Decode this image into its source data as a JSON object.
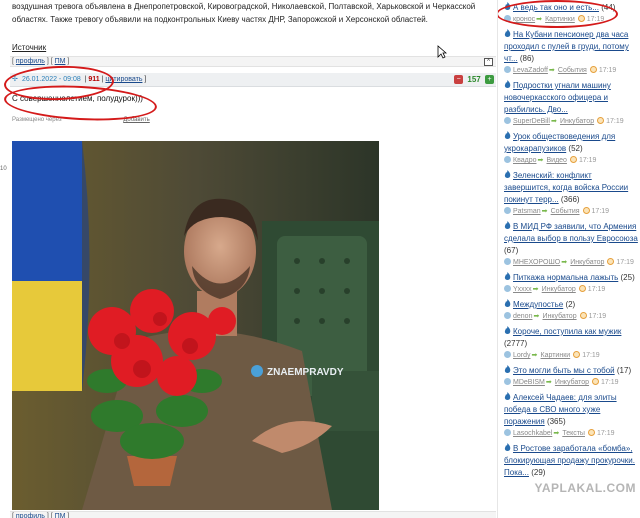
{
  "post": {
    "text": "воздушная тревога объявлена в Днепропетровской, Кировоградской, Николаевской, Полтавской, Харьковской и Черкасской областях. Также тревогу объявили на подконтрольных Киеву частях ДНР, Запорожской и Херсонской областей.",
    "source_link": "Источник"
  },
  "footer_links": {
    "profile": "профиль",
    "pm": "ПМ",
    "up": "^"
  },
  "comment": {
    "date": "26.01.2022 - 09:08",
    "number": "911",
    "quote": "цитировать",
    "score": "157",
    "text": "С совершеннолетием, полудурок)))",
    "meta_prefix": "Размещено через",
    "meta_link": "Добавить"
  },
  "side_number": "10",
  "photo": {
    "watermark": "ZNAEMPRAVDY"
  },
  "sidebar": {
    "items": [
      {
        "title": "А ведь так оно и есть...",
        "count": "(44)",
        "user": "кронос",
        "cat": "Картинки",
        "time": "17:19"
      },
      {
        "title": "На Кубани пенсионер два часа проходил с пулей в груди, потому чт...",
        "count": "(86)",
        "user": "LevaZadoff",
        "cat": "События",
        "time": "17:19"
      },
      {
        "title": "Подростки угнали машину новочеркасского офицера и разбились. Дво...",
        "count": "",
        "user": "SuperDeBill",
        "cat": "Инкубатор",
        "time": "17:19"
      },
      {
        "title": "Урок обществоведения для укрокарапузиков",
        "count": "(52)",
        "user": "Квадро",
        "cat": "Видео",
        "time": "17:19"
      },
      {
        "title": "Зеленский: конфликт завершится, когда войска России покинут терр...",
        "count": "(366)",
        "user": "Patsman",
        "cat": "События",
        "time": "17:19"
      },
      {
        "title": "В МИД РФ заявили, что Армения сделала выбор в пользу Евросоюза",
        "count": "(67)",
        "user": "МНЕХОРОШО",
        "cat": "Инкубатор",
        "time": "17:19"
      },
      {
        "title": "Питкажа нормальна лажыть",
        "count": "(25)",
        "user": "Yxxxx",
        "cat": "Инкубатор",
        "time": "17:19"
      },
      {
        "title": "Междупостье",
        "count": "(2)",
        "user": "denon",
        "cat": "Инкубатор",
        "time": "17:19"
      },
      {
        "title": "Короче, поступила как мужик",
        "count": "(2777)",
        "user": "Lordy",
        "cat": "Картинки",
        "time": "17:19"
      },
      {
        "title": "Это могли быть мы с тобой",
        "count": "(17)",
        "user": "MDeBISM",
        "cat": "Инкубатор",
        "time": "17:19"
      },
      {
        "title": "Алексей Чадаев: для элиты победа в СВО много хуже поражения",
        "count": "(365)",
        "user": "Lasochkabel",
        "cat": "Тексты",
        "time": "17:19"
      },
      {
        "title": "В Ростове заработала «бомба», блокирующая продажу прокурочки. Пока...",
        "count": "(29)",
        "user": "",
        "cat": "",
        "time": ""
      }
    ]
  },
  "watermark": "YAPLAKAL.COM"
}
